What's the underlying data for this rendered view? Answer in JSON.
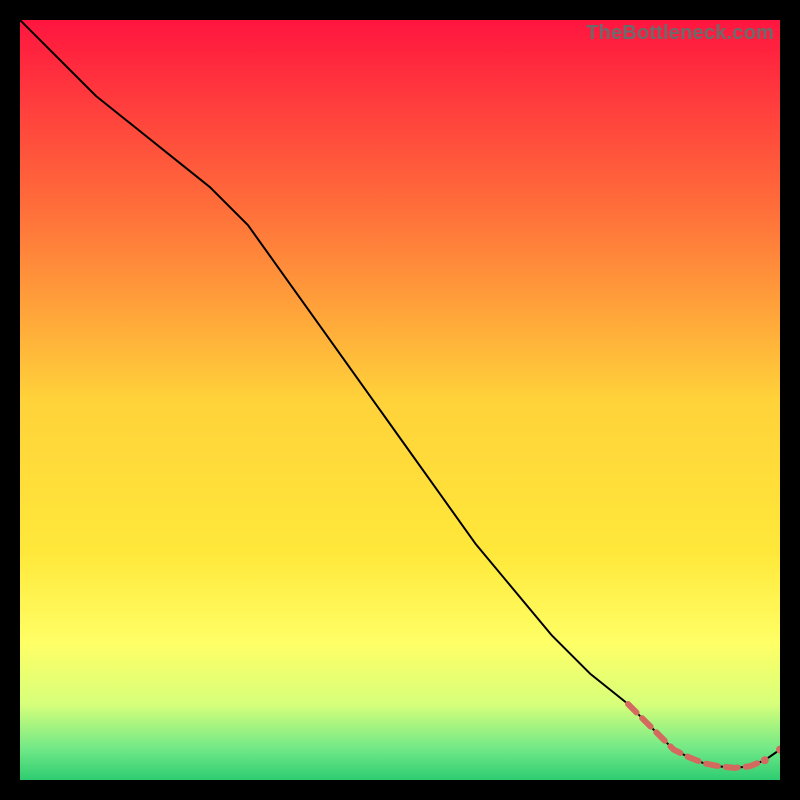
{
  "watermark": "TheBottleneck.com",
  "chart_data": {
    "type": "line",
    "title": "",
    "xlabel": "",
    "ylabel": "",
    "xlim": [
      0,
      100
    ],
    "ylim": [
      0,
      100
    ],
    "grid": false,
    "legend": false,
    "gradient_stops": [
      {
        "offset": 0,
        "color": "#ff153f"
      },
      {
        "offset": 0.25,
        "color": "#ff6f3a"
      },
      {
        "offset": 0.5,
        "color": "#ffd23a"
      },
      {
        "offset": 0.7,
        "color": "#ffe83a"
      },
      {
        "offset": 0.82,
        "color": "#ffff66"
      },
      {
        "offset": 0.9,
        "color": "#d7ff7a"
      },
      {
        "offset": 0.96,
        "color": "#6fe887"
      },
      {
        "offset": 1.0,
        "color": "#2ecc71"
      }
    ],
    "series": [
      {
        "name": "main-curve",
        "color": "#000000",
        "stroke_width": 2,
        "x": [
          0,
          5,
          10,
          15,
          20,
          25,
          30,
          35,
          40,
          45,
          50,
          55,
          60,
          65,
          70,
          75,
          80,
          82,
          84,
          86,
          88,
          90,
          92,
          94,
          96,
          98,
          100
        ],
        "y": [
          100,
          95,
          90,
          86,
          82,
          78,
          73,
          66,
          59,
          52,
          45,
          38,
          31,
          25,
          19,
          14,
          10,
          8,
          6,
          4,
          3,
          2.2,
          1.8,
          1.6,
          1.8,
          2.6,
          4
        ]
      },
      {
        "name": "red-dash-segment",
        "color": "#d46a5f",
        "stroke_width": 6,
        "dash": "12 8",
        "x": [
          80,
          82,
          84,
          86,
          88,
          90,
          92,
          94,
          96,
          98
        ],
        "y": [
          10,
          8,
          6,
          4,
          3,
          2.2,
          1.8,
          1.6,
          1.8,
          2.6
        ]
      }
    ],
    "points": [
      {
        "x": 98,
        "y": 2.6,
        "r": 4,
        "color": "#d46a5f"
      },
      {
        "x": 100,
        "y": 4.0,
        "r": 4,
        "color": "#d46a5f"
      }
    ]
  }
}
